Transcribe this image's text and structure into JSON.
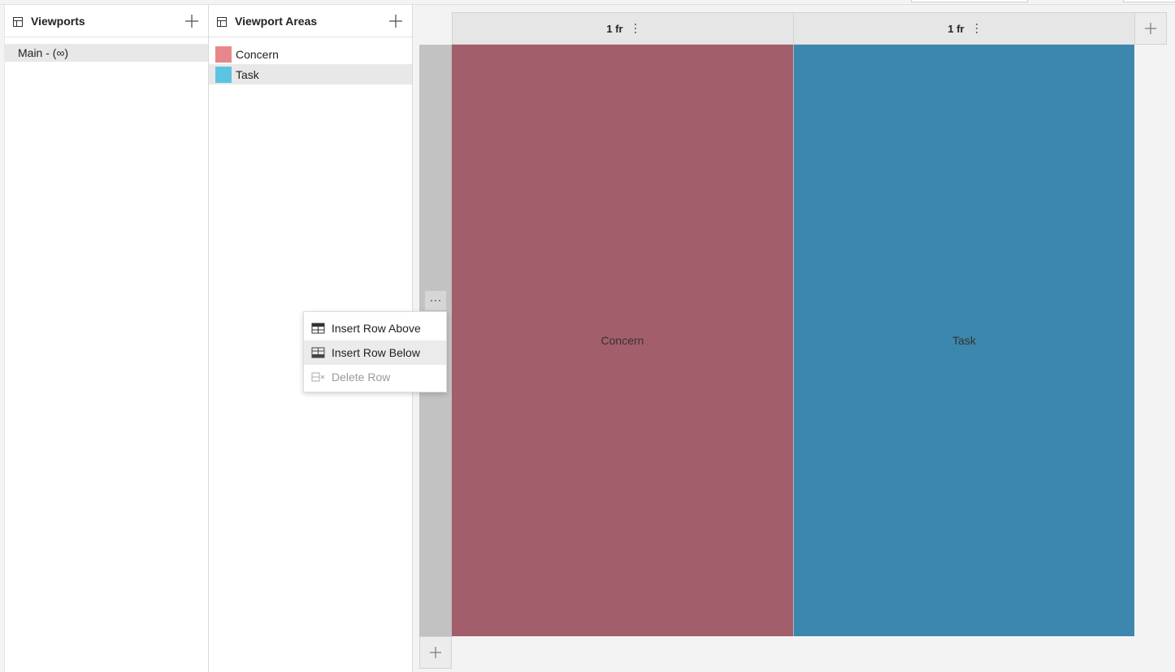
{
  "viewports_panel": {
    "title": "Viewports",
    "header_icon": "grid-icon",
    "add_icon": "plus-icon",
    "items": [
      {
        "label": "Main - (∞)",
        "selected": true
      }
    ]
  },
  "areas_panel": {
    "title": "Viewport Areas",
    "header_icon": "grid-icon",
    "add_icon": "plus-icon",
    "items": [
      {
        "label": "Concern",
        "color": "#e8878a",
        "selected": false
      },
      {
        "label": "Task",
        "color": "#5bc4e0",
        "selected": true
      }
    ]
  },
  "grid": {
    "columns": [
      {
        "label": "1 fr",
        "menu_icon": "kebab-vertical-icon"
      },
      {
        "label": "1 fr",
        "menu_icon": "kebab-vertical-icon"
      }
    ],
    "add_column_icon": "plus-icon",
    "add_row_icon": "plus-icon",
    "row_menu_icon": "kebab-horizontal-icon",
    "cells": [
      {
        "label": "Concern",
        "color": "#a35e6c"
      },
      {
        "label": "Task",
        "color": "#3c87ad"
      }
    ]
  },
  "context_menu": {
    "items": [
      {
        "label": "Insert Row Above",
        "icon": "insert-row-above-icon",
        "enabled": true,
        "hovered": false
      },
      {
        "label": "Insert Row Below",
        "icon": "insert-row-below-icon",
        "enabled": true,
        "hovered": true
      },
      {
        "label": "Delete Row",
        "icon": "delete-row-icon",
        "enabled": false,
        "hovered": false
      }
    ]
  }
}
